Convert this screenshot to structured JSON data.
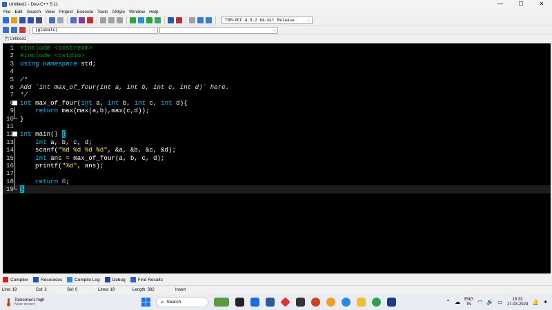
{
  "window": {
    "title": "Untitled1 - Dev-C++ 5.11",
    "controls": [
      "—",
      "☐",
      "✕"
    ]
  },
  "menu": [
    "File",
    "Edit",
    "Search",
    "View",
    "Project",
    "Execute",
    "Tools",
    "AStyle",
    "Window",
    "Help"
  ],
  "toolbar": {
    "compiler": "TDM-GCC 4.9.2 64-bit Release",
    "globals": "(globals)",
    "icons": [
      "new-file-icon",
      "open-icon",
      "save-icon",
      "save-all-icon",
      "close-icon",
      "undo-icon",
      "redo-icon",
      "find-icon",
      "replace-icon",
      "goto-icon",
      "compile-icon",
      "run-icon",
      "compile-run-icon",
      "rebuild-icon",
      "debug-icon",
      "stop-icon",
      "indent-icon",
      "unindent-icon",
      "toggle-comment-icon",
      "bookmark-icon"
    ]
  },
  "tab": {
    "label": "[*] Untitled1"
  },
  "editor": {
    "lines": [
      {
        "n": "1",
        "fold": "",
        "tokens": [
          [
            "pp",
            "#include <iostream>"
          ]
        ]
      },
      {
        "n": "2",
        "fold": "",
        "tokens": [
          [
            "pp",
            "#include <cstdio>"
          ]
        ]
      },
      {
        "n": "3",
        "fold": "",
        "tokens": [
          [
            "kw",
            "using namespace "
          ],
          [
            "plain",
            "std;"
          ]
        ]
      },
      {
        "n": "4",
        "fold": "",
        "tokens": []
      },
      {
        "n": "5",
        "fold": "",
        "tokens": [
          [
            "cm",
            "/*"
          ]
        ]
      },
      {
        "n": "6",
        "fold": "",
        "tokens": [
          [
            "cm",
            "Add `int max_of_four(int a, int b, int c, int d)` here."
          ]
        ]
      },
      {
        "n": "7",
        "fold": "",
        "tokens": [
          [
            "cm",
            "*/"
          ]
        ]
      },
      {
        "n": "8",
        "fold": "start",
        "tokens": [
          [
            "kw",
            "int "
          ],
          [
            "plain",
            "max_of_four("
          ],
          [
            "kw",
            "int "
          ],
          [
            "plain",
            "a, "
          ],
          [
            "kw",
            "int "
          ],
          [
            "plain",
            "b, "
          ],
          [
            "kw",
            "int "
          ],
          [
            "plain",
            "c, "
          ],
          [
            "kw",
            "int "
          ],
          [
            "plain",
            "d){"
          ]
        ]
      },
      {
        "n": "9",
        "fold": "mid",
        "tokens": [
          [
            "plain",
            "    "
          ],
          [
            "kw",
            "return "
          ],
          [
            "plain",
            "max(max(a,b),max(c,d));"
          ]
        ]
      },
      {
        "n": "10",
        "fold": "end",
        "tokens": [
          [
            "plain",
            "}"
          ]
        ]
      },
      {
        "n": "11",
        "fold": "",
        "tokens": []
      },
      {
        "n": "12",
        "fold": "start",
        "tokens": [
          [
            "kw",
            "int "
          ],
          [
            "plain",
            "main() "
          ],
          [
            "brace-hl",
            "{"
          ]
        ]
      },
      {
        "n": "13",
        "fold": "mid",
        "tokens": [
          [
            "plain",
            "    "
          ],
          [
            "kw",
            "int "
          ],
          [
            "plain",
            "a, b, c, d;"
          ]
        ]
      },
      {
        "n": "14",
        "fold": "mid",
        "tokens": [
          [
            "plain",
            "    scanf("
          ],
          [
            "str",
            "\"%d %d %d %d\""
          ],
          [
            "plain",
            ", &a, &b, &c, &d);"
          ]
        ]
      },
      {
        "n": "15",
        "fold": "mid",
        "tokens": [
          [
            "plain",
            "    "
          ],
          [
            "kw",
            "int "
          ],
          [
            "plain",
            "ans = max_of_four(a, b, c, d);"
          ]
        ]
      },
      {
        "n": "16",
        "fold": "mid",
        "tokens": [
          [
            "plain",
            "    printf("
          ],
          [
            "str",
            "\"%d\""
          ],
          [
            "plain",
            ", ans);"
          ]
        ]
      },
      {
        "n": "17",
        "fold": "mid",
        "tokens": []
      },
      {
        "n": "18",
        "fold": "mid",
        "tokens": [
          [
            "plain",
            "    "
          ],
          [
            "kw",
            "return "
          ],
          [
            "num",
            "0"
          ],
          [
            "plain",
            ";"
          ]
        ]
      },
      {
        "n": "19",
        "fold": "end",
        "tokens": [
          [
            "brace-hl",
            "}"
          ]
        ],
        "current": true
      }
    ]
  },
  "output_tabs": [
    {
      "label": "Compiler",
      "icon": "compiler-icon",
      "color": "#d02020"
    },
    {
      "label": "Resources",
      "icon": "resources-icon",
      "color": "#2050c0"
    },
    {
      "label": "Compile Log",
      "icon": "compile-log-icon",
      "color": "#2090d0"
    },
    {
      "label": "Debug",
      "icon": "debug-icon",
      "color": "#2040a0"
    },
    {
      "label": "Find Results",
      "icon": "find-results-icon",
      "color": "#3060c0"
    }
  ],
  "status": {
    "line": "Line:   19",
    "col": "Col:   2",
    "sel": "Sel:   0",
    "lines": "Lines:   19",
    "length": "Length:   382",
    "mode": "Insert"
  },
  "taskbar": {
    "weather_title": "Tomorrow's high",
    "weather_sub": "Near record",
    "search_placeholder": "Search",
    "lang_top": "ENG",
    "lang_bottom": "IN",
    "time": "19:33",
    "date": "17-03-2024"
  }
}
